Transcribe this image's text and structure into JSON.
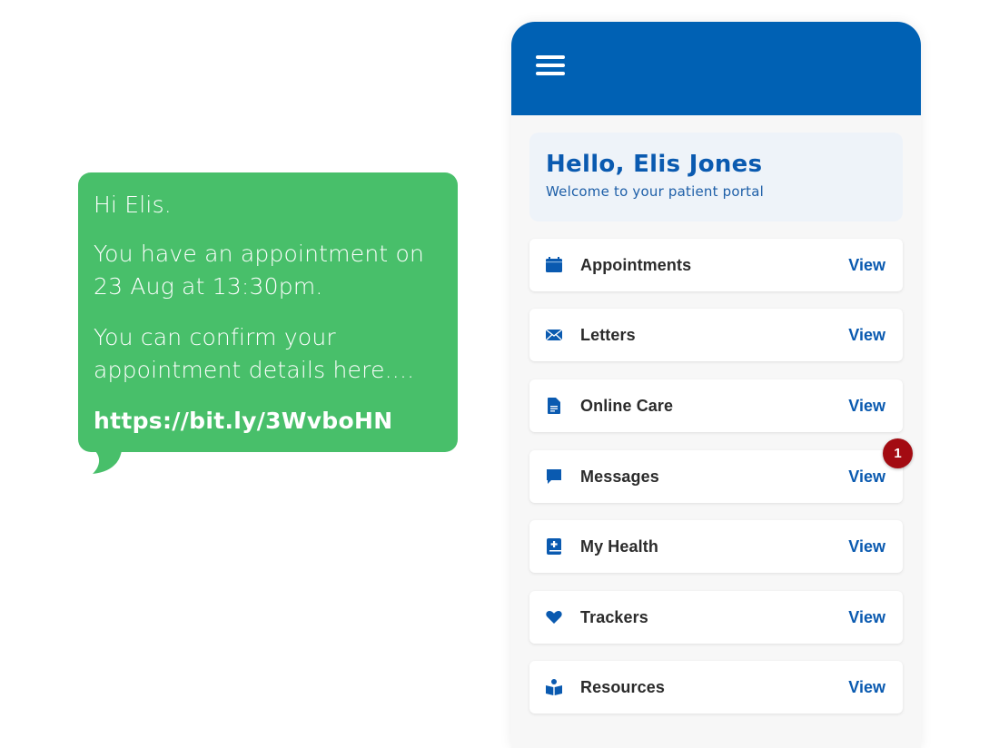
{
  "sms": {
    "greeting": "Hi Elis.",
    "line1": "You have an appointment on",
    "line2": "23 Aug at 13:30pm.",
    "line3": "You can confirm your",
    "line4": "appointment details here....",
    "link": "https://bit.ly/3WvboHN",
    "color": "#48bf6a"
  },
  "portal": {
    "header_color": "#0061b4",
    "menu_icon": "hamburger-menu-icon",
    "greeting_title": "Hello, Elis Jones",
    "greeting_subtitle": "Welcome to your patient portal",
    "items": [
      {
        "label": "Appointments",
        "action": "View",
        "icon": "calendar-icon"
      },
      {
        "label": "Letters",
        "action": "View",
        "icon": "envelope-icon"
      },
      {
        "label": "Online Care",
        "action": "View",
        "icon": "document-icon"
      },
      {
        "label": "Messages",
        "action": "View",
        "icon": "chat-bubble-icon",
        "badge": "1"
      },
      {
        "label": "My Health",
        "action": "View",
        "icon": "medical-book-icon"
      },
      {
        "label": "Trackers",
        "action": "View",
        "icon": "heart-icon"
      },
      {
        "label": "Resources",
        "action": "View",
        "icon": "reader-icon"
      }
    ],
    "badge_color": "#a30b12"
  }
}
